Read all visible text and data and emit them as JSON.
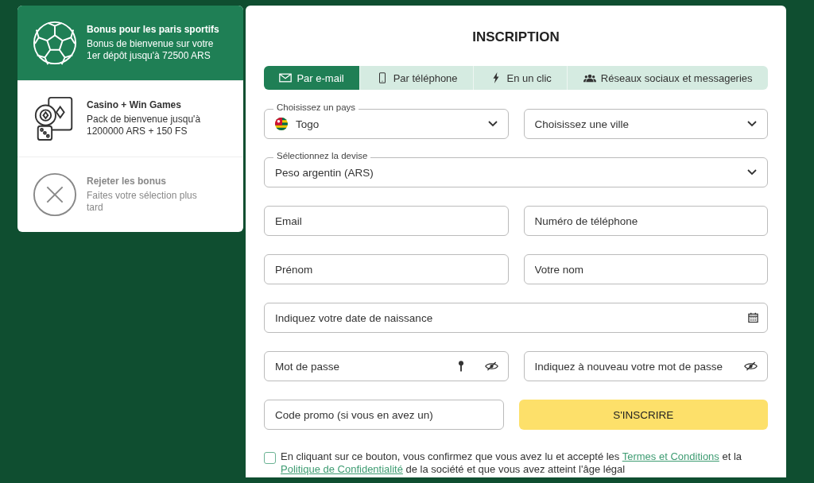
{
  "bonuses": [
    {
      "kind": "sports",
      "title": "Bonus pour les paris sportifs",
      "text": "Bonus de bienvenue sur votre 1er dépôt jusqu'à 72500 ARS",
      "selected": true
    },
    {
      "kind": "casino",
      "title": "Casino + Win Games",
      "text": "Pack de bienvenue jusqu'à 1200000 ARS + 150 FS",
      "selected": false
    },
    {
      "kind": "reject",
      "title": "Rejeter les bonus",
      "text": "Faites votre sélection plus tard",
      "selected": false
    }
  ],
  "form": {
    "title": "INSCRIPTION",
    "tabs": [
      {
        "label": "Par e-mail",
        "selected": true
      },
      {
        "label": "Par téléphone",
        "selected": false
      },
      {
        "label": "En un clic",
        "selected": false
      },
      {
        "label": "Réseaux sociaux et messageries",
        "selected": false
      }
    ],
    "rows": [
      [
        {
          "kind": "country",
          "label": "Choisissez un pays",
          "value": "Togo"
        },
        {
          "kind": "select",
          "placeholder": "Choisissez une ville"
        }
      ],
      [
        {
          "kind": "select",
          "label": "Sélectionnez la devise",
          "value": "Peso argentin (ARS)"
        }
      ],
      [
        {
          "kind": "text",
          "placeholder": "Email"
        },
        {
          "kind": "text",
          "placeholder": "Numéro de téléphone"
        }
      ],
      [
        {
          "kind": "text",
          "placeholder": "Prénom"
        },
        {
          "kind": "text",
          "placeholder": "Votre nom"
        }
      ],
      [
        {
          "kind": "date",
          "placeholder": "Indiquez votre date de naissance"
        }
      ],
      [
        {
          "kind": "password-generate",
          "placeholder": "Mot de passe"
        },
        {
          "kind": "password",
          "placeholder": "Indiquez à nouveau votre mot de passe"
        }
      ],
      [
        {
          "kind": "text",
          "placeholder": "Code promo (si vous en avez un)"
        },
        {
          "kind": "submit",
          "label": "S'INSCRIRE"
        }
      ]
    ],
    "consent": {
      "checked": false,
      "parts": [
        {
          "kind": "text",
          "text": "En cliquant sur ce bouton, vous confirmez que vous avez lu et accepté les "
        },
        {
          "kind": "link",
          "text": "Termes et Conditions"
        },
        {
          "kind": "text",
          "text": " et la "
        },
        {
          "kind": "link",
          "text": "Politique de Confidentialité"
        },
        {
          "kind": "text",
          "text": " de la société et que vous avez atteint l'âge légal"
        }
      ]
    }
  }
}
